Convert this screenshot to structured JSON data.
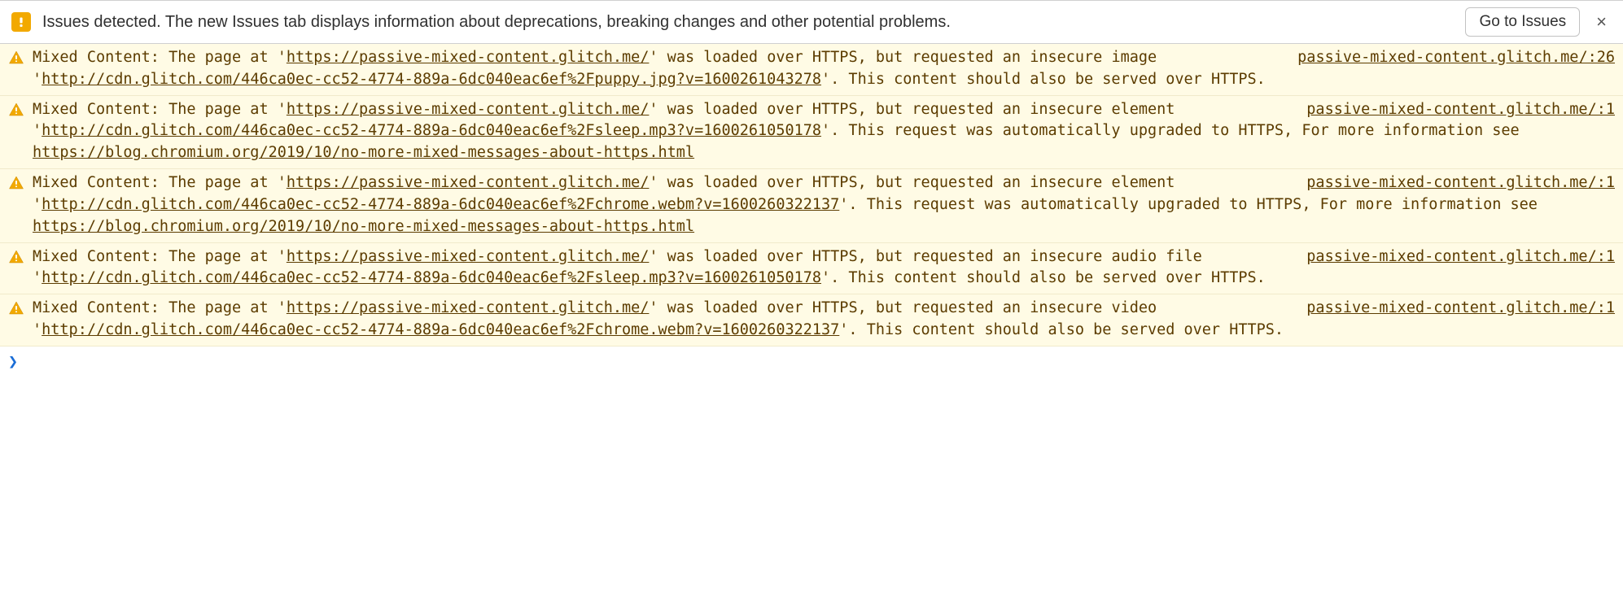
{
  "header": {
    "issues_text": "Issues detected. The new Issues tab displays information about deprecations, breaking changes and other potential problems.",
    "go_to_issues_label": "Go to Issues",
    "close_label": "×"
  },
  "warnings": [
    {
      "source": "passive-mixed-content.glitch.me/:26",
      "segments": [
        {
          "t": "text",
          "v": "Mixed Content: The page at '"
        },
        {
          "t": "link",
          "v": "https://passive-mixed-content.glitch.me/"
        },
        {
          "t": "text",
          "v": "' was loaded over HTTPS, but requested an insecure image '"
        },
        {
          "t": "link",
          "v": "http://cdn.glitch.com/446ca0ec-cc52-4774-889a-6dc040eac6ef%2Fpuppy.jpg?v=1600261043278"
        },
        {
          "t": "text",
          "v": "'. This content should also be served over HTTPS."
        }
      ]
    },
    {
      "source": "passive-mixed-content.glitch.me/:1",
      "segments": [
        {
          "t": "text",
          "v": "Mixed Content: The page at '"
        },
        {
          "t": "link",
          "v": "https://passive-mixed-content.glitch.me/"
        },
        {
          "t": "text",
          "v": "' was loaded over HTTPS, but requested an insecure element '"
        },
        {
          "t": "link",
          "v": "http://cdn.glitch.com/446ca0ec-cc52-4774-889a-6dc040eac6ef%2Fsleep.mp3?v=1600261050178"
        },
        {
          "t": "text",
          "v": "'. This request was automatically upgraded to HTTPS, For more information see "
        },
        {
          "t": "link",
          "v": "https://blog.chromium.org/2019/10/no-more-mixed-messages-about-https.html"
        }
      ]
    },
    {
      "source": "passive-mixed-content.glitch.me/:1",
      "segments": [
        {
          "t": "text",
          "v": "Mixed Content: The page at '"
        },
        {
          "t": "link",
          "v": "https://passive-mixed-content.glitch.me/"
        },
        {
          "t": "text",
          "v": "' was loaded over HTTPS, but requested an insecure element '"
        },
        {
          "t": "link",
          "v": "http://cdn.glitch.com/446ca0ec-cc52-4774-889a-6dc040eac6ef%2Fchrome.webm?v=1600260322137"
        },
        {
          "t": "text",
          "v": "'. This request was automatically upgraded to HTTPS, For more information see "
        },
        {
          "t": "link",
          "v": "https://blog.chromium.org/2019/10/no-more-mixed-messages-about-https.html"
        }
      ]
    },
    {
      "source": "passive-mixed-content.glitch.me/:1",
      "segments": [
        {
          "t": "text",
          "v": "Mixed Content: The page at '"
        },
        {
          "t": "link",
          "v": "https://passive-mixed-content.glitch.me/"
        },
        {
          "t": "text",
          "v": "' was loaded over HTTPS, but requested an insecure audio file '"
        },
        {
          "t": "link",
          "v": "http://cdn.glitch.com/446ca0ec-cc52-4774-889a-6dc040eac6ef%2Fsleep.mp3?v=1600261050178"
        },
        {
          "t": "text",
          "v": "'. This content should also be served over HTTPS."
        }
      ]
    },
    {
      "source": "passive-mixed-content.glitch.me/:1",
      "segments": [
        {
          "t": "text",
          "v": "Mixed Content: The page at '"
        },
        {
          "t": "link",
          "v": "https://passive-mixed-content.glitch.me/"
        },
        {
          "t": "text",
          "v": "' was loaded over HTTPS, but requested an insecure video '"
        },
        {
          "t": "link",
          "v": "http://cdn.glitch.com/446ca0ec-cc52-4774-889a-6dc040eac6ef%2Fchrome.webm?v=1600260322137"
        },
        {
          "t": "text",
          "v": "'. This content should also be served over HTTPS."
        }
      ]
    }
  ],
  "prompt": "❯"
}
